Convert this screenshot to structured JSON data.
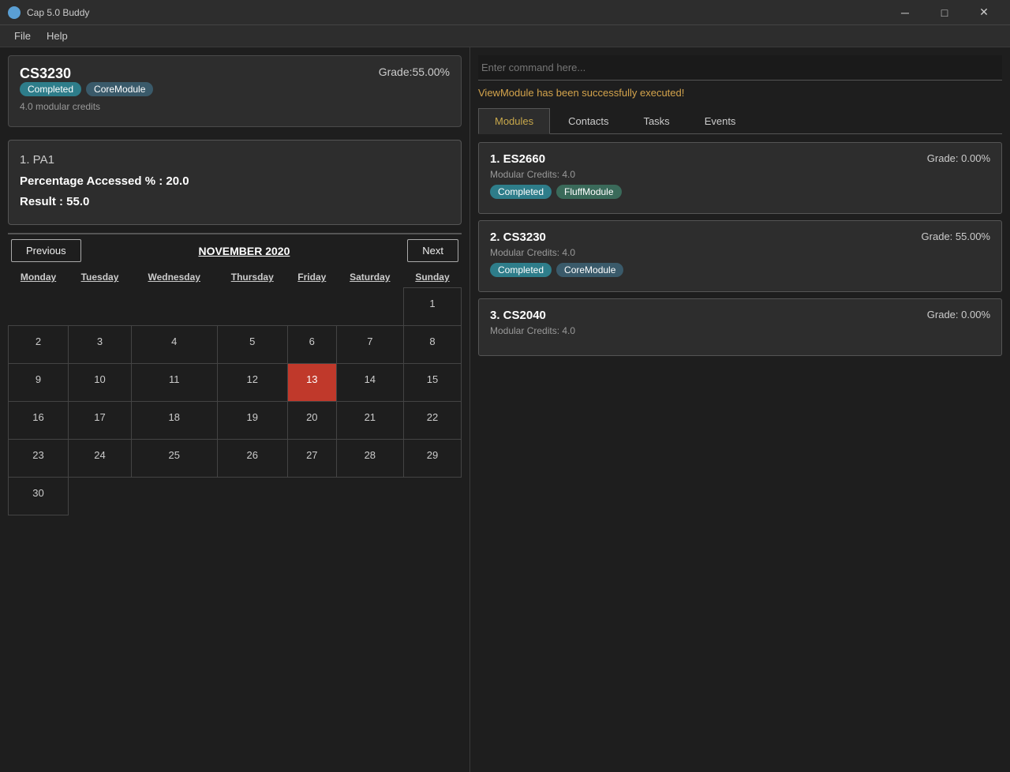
{
  "app": {
    "title": "Cap 5.0 Buddy",
    "icon": "●"
  },
  "titlebar": {
    "minimize": "─",
    "maximize": "□",
    "close": "✕"
  },
  "menubar": {
    "items": [
      "File",
      "Help"
    ]
  },
  "left": {
    "module_card": {
      "title": "CS3230",
      "tag_completed": "Completed",
      "tag_core": "CoreModule",
      "grade_label": "Grade:55.00%",
      "credits": "4.0 modular credits"
    },
    "assessment": {
      "number": "1.  PA1",
      "percentage_label": "Percentage Accessed % : 20.0",
      "result_label": "Result : 55.0"
    },
    "calendar": {
      "prev_label": "Previous",
      "next_label": "Next",
      "month_title": "NOVEMBER 2020",
      "days": [
        "Monday",
        "Tuesday",
        "Wednesday",
        "Thursday",
        "Friday",
        "Saturday",
        "Sunday"
      ],
      "weeks": [
        [
          "",
          "",
          "",
          "",
          "",
          "",
          "1"
        ],
        [
          "2",
          "3",
          "4",
          "5",
          "6",
          "7",
          "8"
        ],
        [
          "9",
          "10",
          "11",
          "12",
          "13",
          "14",
          "15"
        ],
        [
          "16",
          "17",
          "18",
          "19",
          "20",
          "21",
          "22"
        ],
        [
          "23",
          "24",
          "25",
          "26",
          "27",
          "28",
          "29"
        ],
        [
          "30",
          "",
          "",
          "",
          "",
          "",
          ""
        ]
      ],
      "today": "13"
    }
  },
  "right": {
    "command_placeholder": "Enter command here...",
    "success_message": "ViewModule has been successfully executed!",
    "tabs": [
      "Modules",
      "Contacts",
      "Tasks",
      "Events"
    ],
    "active_tab": "Modules",
    "modules": [
      {
        "number": "1.",
        "code": "ES2660",
        "credits": "Modular Credits: 4.0",
        "grade": "Grade: 0.00%",
        "tags": [
          "Completed",
          "FluffModule"
        ]
      },
      {
        "number": "2.",
        "code": "CS3230",
        "credits": "Modular Credits: 4.0",
        "grade": "Grade: 55.00%",
        "tags": [
          "Completed",
          "CoreModule"
        ]
      },
      {
        "number": "3.",
        "code": "CS2040",
        "credits": "Modular Credits: 4.0",
        "grade": "Grade: 0.00%",
        "tags": []
      }
    ]
  }
}
